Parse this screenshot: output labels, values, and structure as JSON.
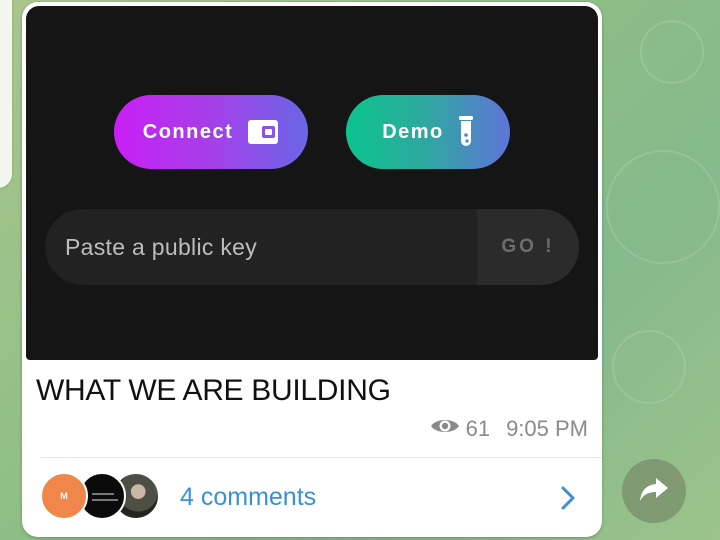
{
  "media": {
    "connect_button": {
      "label": "Connect",
      "icon": "wallet-icon"
    },
    "demo_button": {
      "label": "Demo",
      "icon": "test-tube-icon"
    },
    "public_key_input": {
      "placeholder": "Paste a public key",
      "go_label": "GO !"
    }
  },
  "post": {
    "caption": "WHAT WE ARE BUILDING",
    "views": "61",
    "time": "9:05 PM"
  },
  "comments": {
    "label": "4 comments",
    "first_avatar_initial": "M"
  },
  "colors": {
    "accent_link": "#3a8fd6",
    "connect_gradient_start": "#c91ff5",
    "demo_gradient_start": "#0cc48d"
  }
}
